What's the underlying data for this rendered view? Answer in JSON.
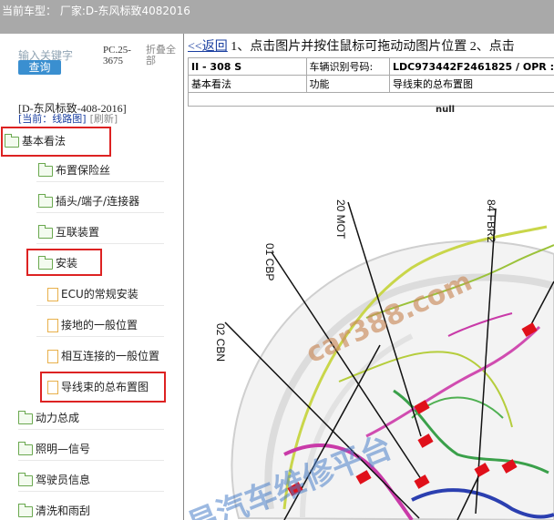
{
  "topbar": {
    "label": "当前车型：",
    "value": "厂家:D-东风标致4082016"
  },
  "sidebar": {
    "search_hint": "输入关键字",
    "search_button": "查询",
    "code": "PC.25-3675",
    "collapse_all": "折叠全部",
    "model": "[D-东风标致-408-2016]",
    "current": "[当前：线路图]",
    "refresh": "[刷新]",
    "items": [
      {
        "label": "基本看法",
        "icon": "folder-open-icon"
      },
      {
        "label": "布置保险丝",
        "icon": "folder-icon"
      },
      {
        "label": "插头/端子/连接器",
        "icon": "folder-icon"
      },
      {
        "label": "互联装置",
        "icon": "folder-icon"
      },
      {
        "label": "安装",
        "icon": "folder-open-icon"
      },
      {
        "label": "ECU的常规安装",
        "icon": "page-icon"
      },
      {
        "label": "接地的一般位置",
        "icon": "page-icon"
      },
      {
        "label": "相互连接的一般位置",
        "icon": "page-icon"
      },
      {
        "label": "导线束的总布置图",
        "icon": "page-icon"
      },
      {
        "label": "动力总成",
        "icon": "folder-icon"
      },
      {
        "label": "照明—信号",
        "icon": "folder-icon"
      },
      {
        "label": "驾驶员信息",
        "icon": "folder-icon"
      },
      {
        "label": "清洗和雨刮",
        "icon": "folder-icon"
      }
    ]
  },
  "main": {
    "back": "<<返回",
    "instructions": " 1、点击图片并按住鼠标可拖动动图片位置 2、点击",
    "header": {
      "model": "II - 308 S",
      "vin_label": "车辆识别号码:",
      "vin_value": "LDC973442F2461825 / OPR :",
      "crumb1": "基本看法",
      "crumb2": "功能",
      "crumb3": "导线束的总布置图"
    },
    "null_text": "null",
    "labels": {
      "mot": "20 MOT",
      "fbr": "84 FBR2",
      "cbp": "01 CBP",
      "cbn": "02 CBN"
    },
    "watermark1": "car388.com",
    "watermark2": "易汽车维修平台"
  },
  "colors": {
    "accent": "#3a8fd0",
    "highlight": "#dd2222",
    "topbar": "#a9a9a9"
  }
}
